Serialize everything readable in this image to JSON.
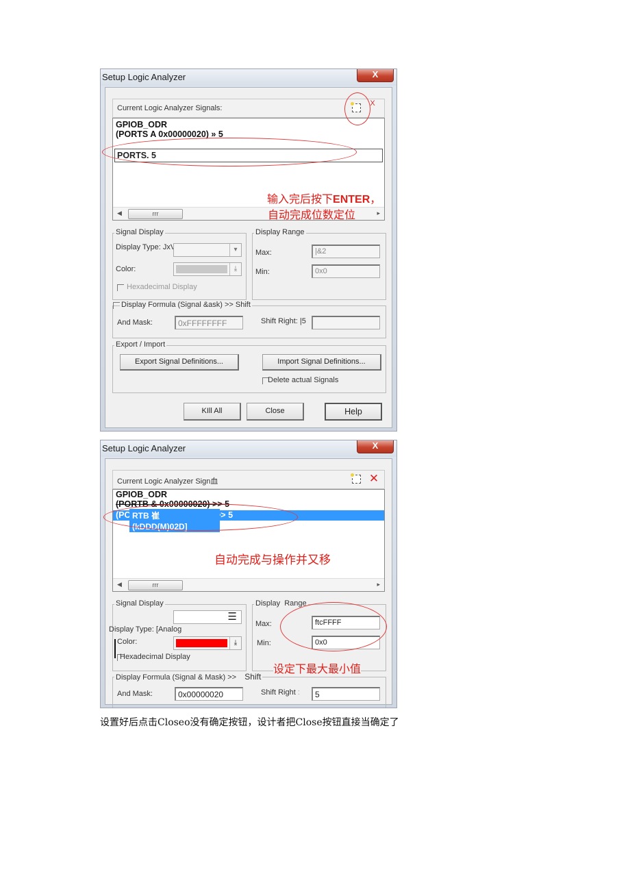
{
  "caption": "设置好后点击Closeo没有确定按钮，设计者把Close按钮直接当确定了",
  "dialog1": {
    "title": "Setup Logic Analyzer",
    "close_glyph": "X",
    "signals_label": "Current Logic Analyzer Signals:",
    "new_icon": "new-signal-icon",
    "delete_glyph": "X",
    "signal_name": "GPIOB_ODR",
    "signal_formula": "(PORTS A 0x00000020) » 5",
    "edit_value": "PORTS. 5",
    "scroll_thumb": "rrr",
    "annotation_line1": "输入完后按下",
    "annotation_line1_bold": "ENTER",
    "annotation_line1_tail": "，",
    "annotation_line2": "自动完成位数定位",
    "signal_display": {
      "group_label": "Signal Display",
      "display_type_label": "Display Type: JxVjalag",
      "color_label": "Color:",
      "color_value": "#c8c8c8",
      "hex_label": "Hexadecimal Display"
    },
    "display_range": {
      "group_label": "Display Range",
      "max_label": "Max:",
      "max_value": "|&2",
      "min_label": "Min:",
      "min_value": "0x0"
    },
    "formula": {
      "group_label": "Display Formula (Signal &ask) >> Shift",
      "and_mask_label": "And Mask:",
      "and_mask_value": "0xFFFFFFFF",
      "shift_label": "Shift Right: |5",
      "shift_value": ""
    },
    "export_import": {
      "group_label": "Export / Import",
      "export_button": "Export Signal Definitions...",
      "import_button": "Import Signal Definitions...",
      "delete_label": "Delete actual Signals"
    },
    "buttons": {
      "kill_all": "KIll All",
      "close": "Close",
      "help": "Help"
    }
  },
  "dialog2": {
    "title": "Setup Logic Analyzer",
    "close_glyph": "X",
    "signals_label": "Current Logic Analyzer Sign血",
    "delete_glyph": "✕",
    "signal_name": "GPIOB_ODR",
    "signal_formula": "(PORTB & 0x00000020) >> 5",
    "selected_prefix": "(PC",
    "selected_suffix": ">> 5",
    "popup_line1": "RTB 崔",
    "popup_line2": "(kDDD(M)02D]",
    "annotation": "自动完成与操作并又移",
    "scroll_thumb": "rrr",
    "signal_display": {
      "group_label": "Signal Display",
      "display_type_label": "Display Type: [Analog",
      "color_label": "Color:",
      "color_value": "#ff0000",
      "hex_label": "Hexadecimal Display"
    },
    "display_range": {
      "group_label_a": "Display",
      "group_label_b": "Range",
      "max_label": "Max:",
      "max_value": "ftcFFFF",
      "min_label": "Min:",
      "min_value": "0x0",
      "annotation": "设定下最大最小值"
    },
    "formula": {
      "group_label": "Display Formula (Signal & Mask) >>",
      "group_label_b": "Shift",
      "and_mask_label": "And Mask:",
      "and_mask_value": "0x00000020",
      "shift_label": "Shift Right",
      "shift_colon": ":",
      "shift_value": "5"
    }
  }
}
